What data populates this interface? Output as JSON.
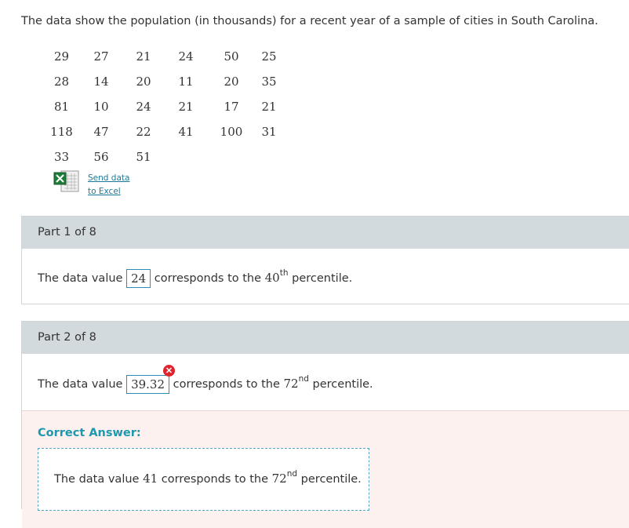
{
  "intro_text": "The data show the population (in thousands) for a recent year of a sample of cities in South Carolina.",
  "data_rows": [
    [
      "29",
      "27",
      "21",
      "24",
      "50",
      "25"
    ],
    [
      "28",
      "14",
      "20",
      "11",
      "20",
      "35"
    ],
    [
      "81",
      "10",
      "24",
      "21",
      "17",
      "21"
    ],
    [
      "118",
      "47",
      "22",
      "41",
      "100",
      "31"
    ],
    [
      "33",
      "56",
      "51"
    ]
  ],
  "excel": {
    "icon": "excel-icon",
    "link_line1": "Send data",
    "link_line2": "to Excel"
  },
  "part1": {
    "title": "Part 1 of 8",
    "pre": "The data value",
    "answer": "24",
    "mid": "corresponds to the",
    "percentile_num": "40",
    "suffix": "th",
    "post": "percentile."
  },
  "part2": {
    "title": "Part 2 of 8",
    "pre": "The data value",
    "answer": "39.32",
    "wrong_icon": "close-icon",
    "mid": "corresponds to the",
    "percentile_num": "72",
    "suffix": "nd",
    "post": "percentile.",
    "correct_label": "Correct Answer:",
    "correct": {
      "pre": "The data value",
      "value": "41",
      "mid": "corresponds to the",
      "percentile_num": "72",
      "suffix": "nd",
      "post": "percentile."
    }
  },
  "colors": {
    "accent": "#2a8db5",
    "correct_label": "#1c98b0",
    "error": "#e0242b",
    "header_bg": "#d3dade",
    "correct_bg": "#fdf1ef"
  }
}
